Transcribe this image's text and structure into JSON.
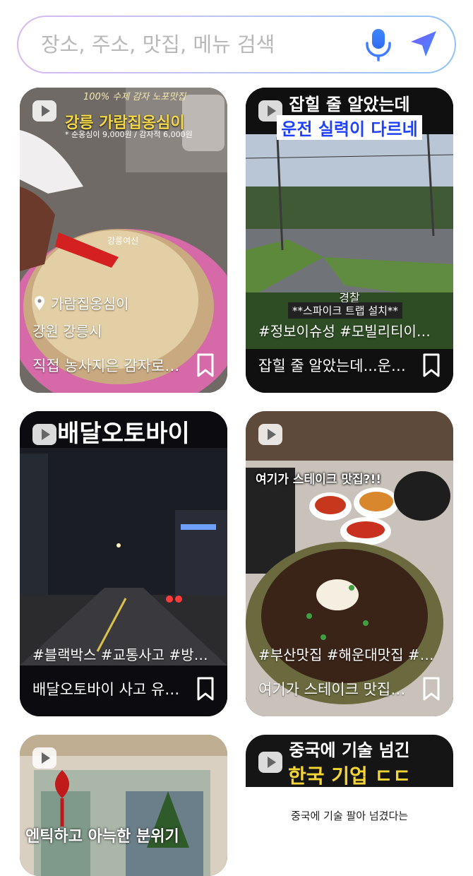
{
  "search": {
    "placeholder": "장소, 주소, 맛집, 메뉴 검색"
  },
  "cards": [
    {
      "overlay_top": "100% 수제 감자 노포맛집",
      "overlay_title": "강릉 가람집옹심이",
      "overlay_sub": "* 순옹심이 9,000원 / 감자적 6,000원",
      "overlay_mid": "강릉여신",
      "location": "가람집옹심이",
      "region": "강원 강릉시",
      "title": "직접 농사지은 감자로…"
    },
    {
      "banner_line1": "잡힐 줄 알았는데",
      "banner_line2": "운전 실력이 다르네",
      "caption_small": "경찰",
      "caption": "**스파이크 트랩 설치**",
      "tags": "#정보이슈성 #모빌리티이슈 …",
      "title": "잡힐 줄 알았는데...운…"
    },
    {
      "banner_line1": "배달오토바이",
      "tags": "#블랙박스 #교통사고 #방어…",
      "title": "배달오토바이 사고 유…"
    },
    {
      "caption": "여기가 스테이크 맛집?!!",
      "tags": "#부산맛집 #해운대맛집 #센…",
      "title": "여기가 스테이크 맛집…"
    },
    {
      "caption": "엔틱하고 아늑한 분위기"
    },
    {
      "banner_line1": "중국에 기술 넘긴",
      "banner_line2": "한국 기업 ㄷㄷ",
      "sub": "중국에 기술 팔아 넘겼다는"
    }
  ]
}
